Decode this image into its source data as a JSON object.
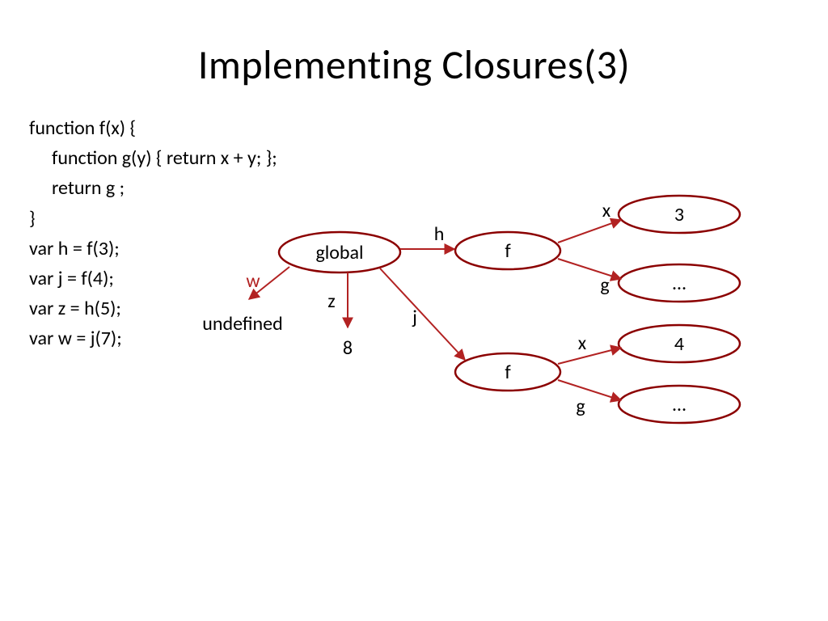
{
  "title": "Implementing Closures(3)",
  "code": {
    "l1": "function f(x) {",
    "l2": "function g(y) { return x + y; };",
    "l3": "return g ;",
    "l4": " }",
    "l5": "var h = f(3);",
    "l6": "var j  = f(4);",
    "l7": "var z = h(5);",
    "l8": "var w = j(7);"
  },
  "nodes": {
    "global": "global",
    "f1": "f",
    "f2": "f",
    "v3": "3",
    "vdots1": "…",
    "v4": "4",
    "vdots2": "…"
  },
  "edges": {
    "h": "h",
    "j": "j",
    "z": "z",
    "w": "w",
    "x1": "x",
    "g1": "g",
    "x2": "x",
    "g2": "g"
  },
  "leaves": {
    "undefined": "undefined",
    "eight": "8"
  },
  "colors": {
    "stroke": "#8b0000",
    "arrow": "#b22222"
  }
}
